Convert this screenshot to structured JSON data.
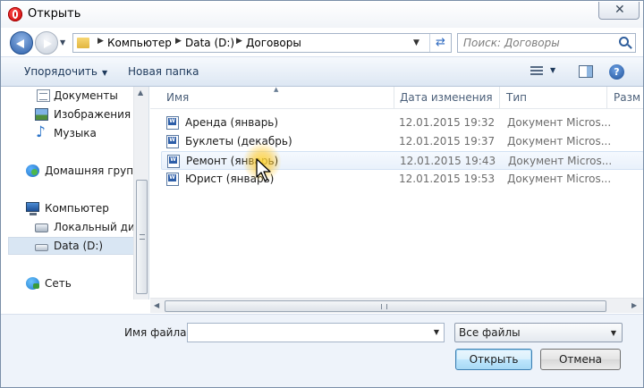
{
  "window": {
    "title": "Открыть"
  },
  "address": {
    "crumbs": [
      "Компьютер",
      "Data (D:)",
      "Договоры"
    ]
  },
  "search": {
    "placeholder": "Поиск: Договоры"
  },
  "toolbar": {
    "organize_label": "Упорядочить",
    "new_folder_label": "Новая папка",
    "help_label": "?"
  },
  "nav": {
    "items": [
      {
        "label": "Документы",
        "icon": "documents-icon"
      },
      {
        "label": "Изображения",
        "icon": "pictures-icon"
      },
      {
        "label": "Музыка",
        "icon": "music-icon"
      },
      {
        "label": "Домашняя группа",
        "icon": "homegroup-icon"
      },
      {
        "label": "Компьютер",
        "icon": "computer-icon"
      },
      {
        "label": "Локальный диск",
        "icon": "local-disk-icon"
      },
      {
        "label": "Data (D:)",
        "icon": "drive-icon",
        "selected": true
      },
      {
        "label": "Сеть",
        "icon": "network-icon"
      }
    ]
  },
  "files": {
    "columns": [
      "Имя",
      "Дата изменения",
      "Тип",
      "Разм"
    ],
    "rows": [
      {
        "name": "Аренда (январь)",
        "date": "12.01.2015 19:32",
        "type": "Документ Micros..."
      },
      {
        "name": "Буклеты (декабрь)",
        "date": "12.01.2015 19:37",
        "type": "Документ Micros..."
      },
      {
        "name": "Ремонт (январь)",
        "date": "12.01.2015 19:43",
        "type": "Документ Micros...",
        "hovered": true
      },
      {
        "name": "Юрист (январь)",
        "date": "12.01.2015 19:53",
        "type": "Документ Micros..."
      }
    ]
  },
  "footer": {
    "filename_label": "Имя файла:",
    "filename_value": "",
    "filter_value": "Все файлы",
    "open_label": "Открыть",
    "cancel_label": "Отмена"
  },
  "colors": {
    "accent": "#2d5ea8",
    "selection": "#d9e6f3",
    "toolbar": "#dde7f3"
  }
}
